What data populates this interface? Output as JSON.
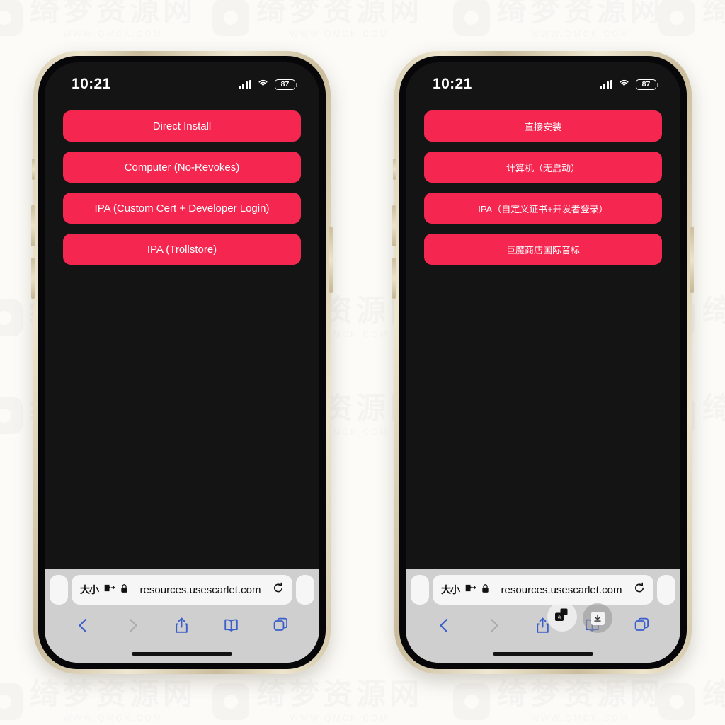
{
  "watermark": {
    "text": "绮梦资源网",
    "url": "WWW.QMCK.COM",
    "logo_icon": "rounded-square-logo-icon"
  },
  "colors": {
    "button_red": "#f5264f",
    "page_background": "#141414",
    "frame_gold": "#dcd0b2",
    "toolbar_grey": "#cfcfcf",
    "safari_blue": "#3b5ecb"
  },
  "phones": [
    {
      "id": "left",
      "language": "en",
      "status_bar": {
        "time": "10:21",
        "signal_icon": "cellular-signal-icon",
        "wifi_icon": "wifi-icon",
        "battery_level": "87",
        "battery_icon": "battery-icon"
      },
      "page": {
        "buttons": [
          {
            "label": "Direct Install"
          },
          {
            "label": "Computer (No-Revokes)"
          },
          {
            "label": "IPA (Custom Cert + Developer Login)"
          },
          {
            "label": "IPA (Trollstore)"
          }
        ]
      },
      "safari": {
        "url_bar": {
          "text_size_label": "大小",
          "text_size_icon": "aa-text-size-icon",
          "extensions_icon": "puzzle-piece-icon",
          "lock_icon": "lock-icon",
          "url": "resources.usescarlet.com",
          "reload_icon": "reload-icon"
        },
        "toolbar": [
          {
            "name": "back",
            "icon": "chevron-left-icon",
            "enabled": true
          },
          {
            "name": "forward",
            "icon": "chevron-right-icon",
            "enabled": false
          },
          {
            "name": "share",
            "icon": "share-icon",
            "enabled": true
          },
          {
            "name": "bookmarks",
            "icon": "book-icon",
            "enabled": true
          },
          {
            "name": "tabs",
            "icon": "tabs-icon",
            "enabled": true
          }
        ],
        "overlays": []
      }
    },
    {
      "id": "right",
      "language": "zh",
      "status_bar": {
        "time": "10:21",
        "signal_icon": "cellular-signal-icon",
        "wifi_icon": "wifi-icon",
        "battery_level": "87",
        "battery_icon": "battery-icon"
      },
      "page": {
        "buttons": [
          {
            "label": "直接安装"
          },
          {
            "label": "计算机（无启动）"
          },
          {
            "label": "IPA（自定义证书+开发者登录）"
          },
          {
            "label": "巨魔商店国际音标"
          }
        ]
      },
      "safari": {
        "url_bar": {
          "text_size_label": "大小",
          "text_size_icon": "aa-text-size-icon",
          "extensions_icon": "puzzle-piece-icon",
          "lock_icon": "lock-icon",
          "url": "resources.usescarlet.com",
          "reload_icon": "reload-icon"
        },
        "toolbar": [
          {
            "name": "back",
            "icon": "chevron-left-icon",
            "enabled": true
          },
          {
            "name": "forward",
            "icon": "chevron-right-icon",
            "enabled": false
          },
          {
            "name": "share",
            "icon": "share-icon",
            "enabled": true
          },
          {
            "name": "bookmarks",
            "icon": "book-icon",
            "enabled": true
          },
          {
            "name": "tabs",
            "icon": "tabs-icon",
            "enabled": true
          }
        ],
        "overlays": [
          {
            "name": "app-switch-badge",
            "icon": "app-switch-icon"
          },
          {
            "name": "download-badge",
            "icon": "download-arrow-icon"
          }
        ]
      }
    }
  ]
}
